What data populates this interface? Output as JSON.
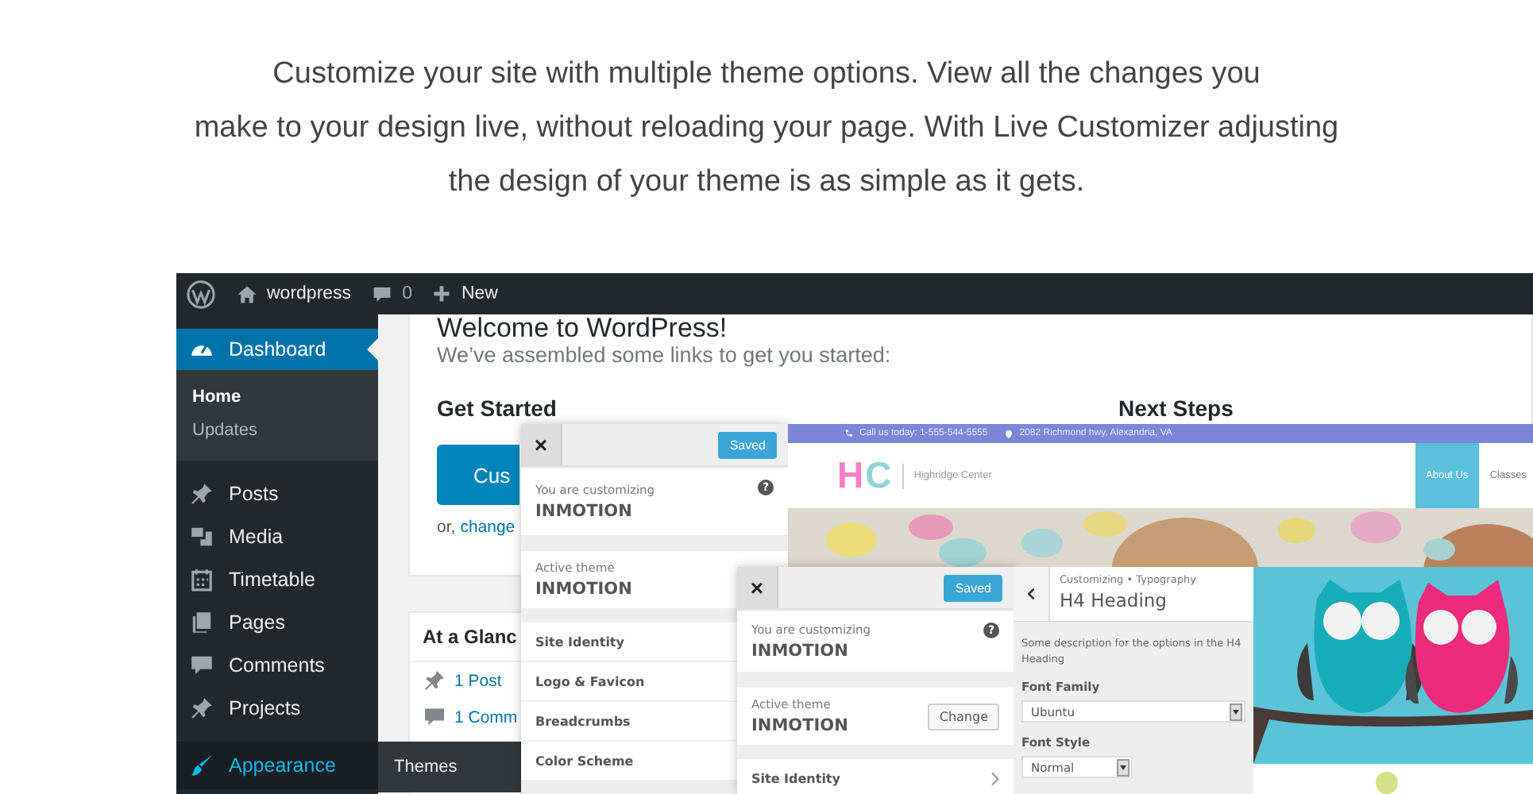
{
  "intro": {
    "text": "Customize your site with multiple theme options. View all the changes you\nmake to your design live, without reloading your page. With Live Customizer adjusting\nthe design of your theme is as simple as it gets."
  },
  "admin_bar": {
    "site_name": "wordpress",
    "comment_count": "0",
    "new_label": "New"
  },
  "sidebar": {
    "items": [
      {
        "label": "Dashboard",
        "selected": true,
        "hovered": false,
        "children": [
          {
            "label": "Home",
            "selected": true
          },
          {
            "label": "Updates",
            "selected": false
          }
        ]
      },
      {
        "label": "Posts",
        "selected": false,
        "hovered": false
      },
      {
        "label": "Media",
        "selected": false,
        "hovered": false
      },
      {
        "label": "Timetable",
        "selected": false,
        "hovered": false
      },
      {
        "label": "Pages",
        "selected": false,
        "hovered": false
      },
      {
        "label": "Comments",
        "selected": false,
        "hovered": false
      },
      {
        "label": "Projects",
        "selected": false,
        "hovered": false
      },
      {
        "label": "Appearance",
        "selected": false,
        "hovered": true,
        "children": [
          {
            "label": "Themes",
            "selected": false
          }
        ]
      }
    ]
  },
  "welcome": {
    "title": "Welcome to WordPress!",
    "subtitle": "We’ve assembled some links to get you started:",
    "columns": [
      "Get Started",
      "Next Steps"
    ],
    "button": "Cus",
    "link_prefix": "or,",
    "link": "change"
  },
  "at_a_glance": {
    "title": "At a Glanc",
    "items": [
      "1 Post",
      "1 Comm"
    ]
  },
  "customizer_panels": [
    {
      "close": "×",
      "save_label": "Saved",
      "customizing_label": "You are customizing",
      "theme": "INMOTION",
      "help": "?",
      "active_theme_label": "Active theme",
      "active_theme": "INMOTION",
      "sections": [
        {
          "label": "Site Identity",
          "arrow": false
        },
        {
          "label": "Logo & Favicon",
          "arrow": false
        },
        {
          "label": "Breadcrumbs",
          "arrow": false
        },
        {
          "label": "Color Scheme",
          "arrow": false
        }
      ]
    },
    {
      "close": "×",
      "save_label": "Saved",
      "customizing_label": "You are customizing",
      "theme": "INMOTION",
      "help": "?",
      "active_theme_label": "Active theme",
      "active_theme": "INMOTION",
      "change_label": "Change",
      "sections": [
        {
          "label": "Site Identity",
          "arrow": true
        }
      ]
    }
  ],
  "site_preview": {
    "phone": "Call us today: 1-555-544-5555",
    "address": "2082 Richmond hwy, Alexandria, VA",
    "logo": [
      {
        "text": "H",
        "color": "#f57fc4"
      },
      {
        "text": "C",
        "color": "#8fd3d9"
      }
    ],
    "site_name": "Highridge Center",
    "nav": [
      {
        "label": "About Us",
        "selected": true
      },
      {
        "label": "Classes",
        "selected": false
      }
    ]
  },
  "typography_panel": {
    "breadcrumb": "Customizing • Typography",
    "title": "H4 Heading",
    "description": "Some description for the options in the H4 Heading",
    "fields": [
      {
        "label": "Font Family",
        "value": "Ubuntu",
        "wide": true
      },
      {
        "label": "Font Style",
        "value": "Normal",
        "wide": false
      }
    ]
  }
}
